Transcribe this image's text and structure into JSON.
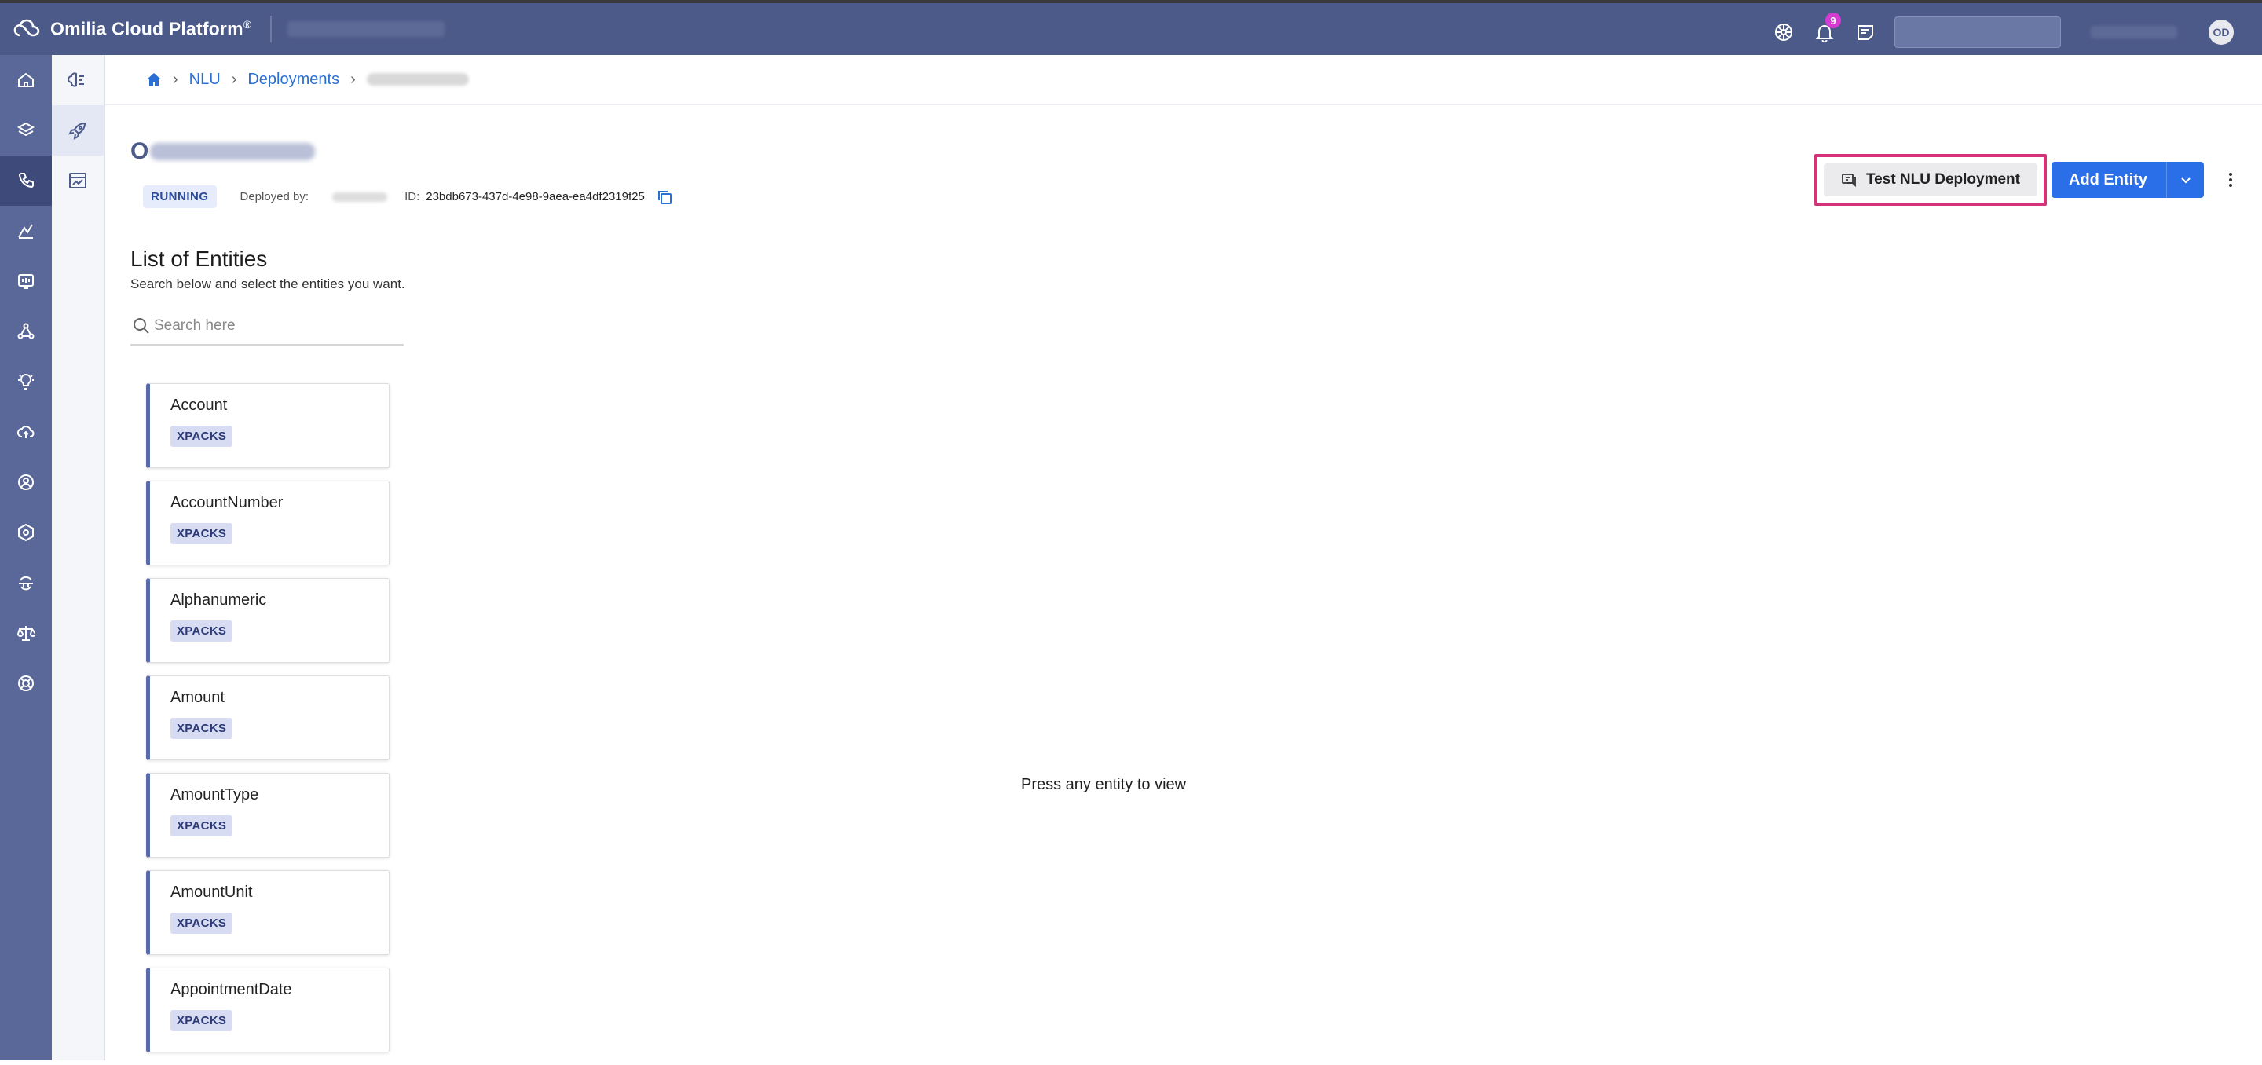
{
  "header": {
    "brand": "Omilia Cloud Platform",
    "brand_mark": "®",
    "notification_count": "9",
    "avatar_initials": "OD"
  },
  "breadcrumb": {
    "items": [
      "NLU",
      "Deployments"
    ]
  },
  "deployment": {
    "title_initial": "O",
    "status": "RUNNING",
    "deployed_by_label": "Deployed by:",
    "id_label": "ID:",
    "id_value": "23bdb673-437d-4e98-9aea-ea4df2319f25"
  },
  "actions": {
    "test_label": "Test NLU Deployment",
    "add_label": "Add Entity"
  },
  "entities": {
    "title": "List of Entities",
    "subtitle": "Search below and select the entities you want.",
    "search_placeholder": "Search here",
    "items": [
      {
        "name": "Account",
        "tag": "XPACKS"
      },
      {
        "name": "AccountNumber",
        "tag": "XPACKS"
      },
      {
        "name": "Alphanumeric",
        "tag": "XPACKS"
      },
      {
        "name": "Amount",
        "tag": "XPACKS"
      },
      {
        "name": "AmountType",
        "tag": "XPACKS"
      },
      {
        "name": "AmountUnit",
        "tag": "XPACKS"
      },
      {
        "name": "AppointmentDate",
        "tag": "XPACKS"
      }
    ],
    "empty_message": "Press any entity to view"
  }
}
